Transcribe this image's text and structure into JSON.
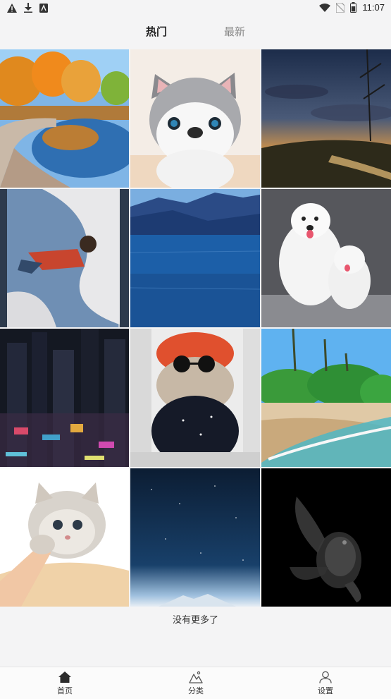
{
  "status_bar": {
    "time": "11:07",
    "left_icons": [
      "warning-icon",
      "download-icon",
      "app-icon"
    ],
    "right_icons": [
      "wifi-icon",
      "no-sim-icon",
      "battery-icon"
    ]
  },
  "tabs": [
    {
      "label": "热门",
      "active": true
    },
    {
      "label": "最新",
      "active": false
    }
  ],
  "gallery": {
    "items": [
      {
        "subject": "autumn pond"
      },
      {
        "subject": "husky puppy"
      },
      {
        "subject": "sunset field"
      },
      {
        "subject": "boy in painting"
      },
      {
        "subject": "blue lake"
      },
      {
        "subject": "samoyed dogs"
      },
      {
        "subject": "night city"
      },
      {
        "subject": "cat with hat"
      },
      {
        "subject": "tropical beach"
      },
      {
        "subject": "kitten paw"
      },
      {
        "subject": "starry sky"
      },
      {
        "subject": "black goldfish"
      }
    ],
    "end_text": "没有更多了"
  },
  "bottom_nav": [
    {
      "label": "首页",
      "icon": "home-icon",
      "active": true
    },
    {
      "label": "分类",
      "icon": "mountain-icon",
      "active": false
    },
    {
      "label": "设置",
      "icon": "person-icon",
      "active": false
    }
  ]
}
